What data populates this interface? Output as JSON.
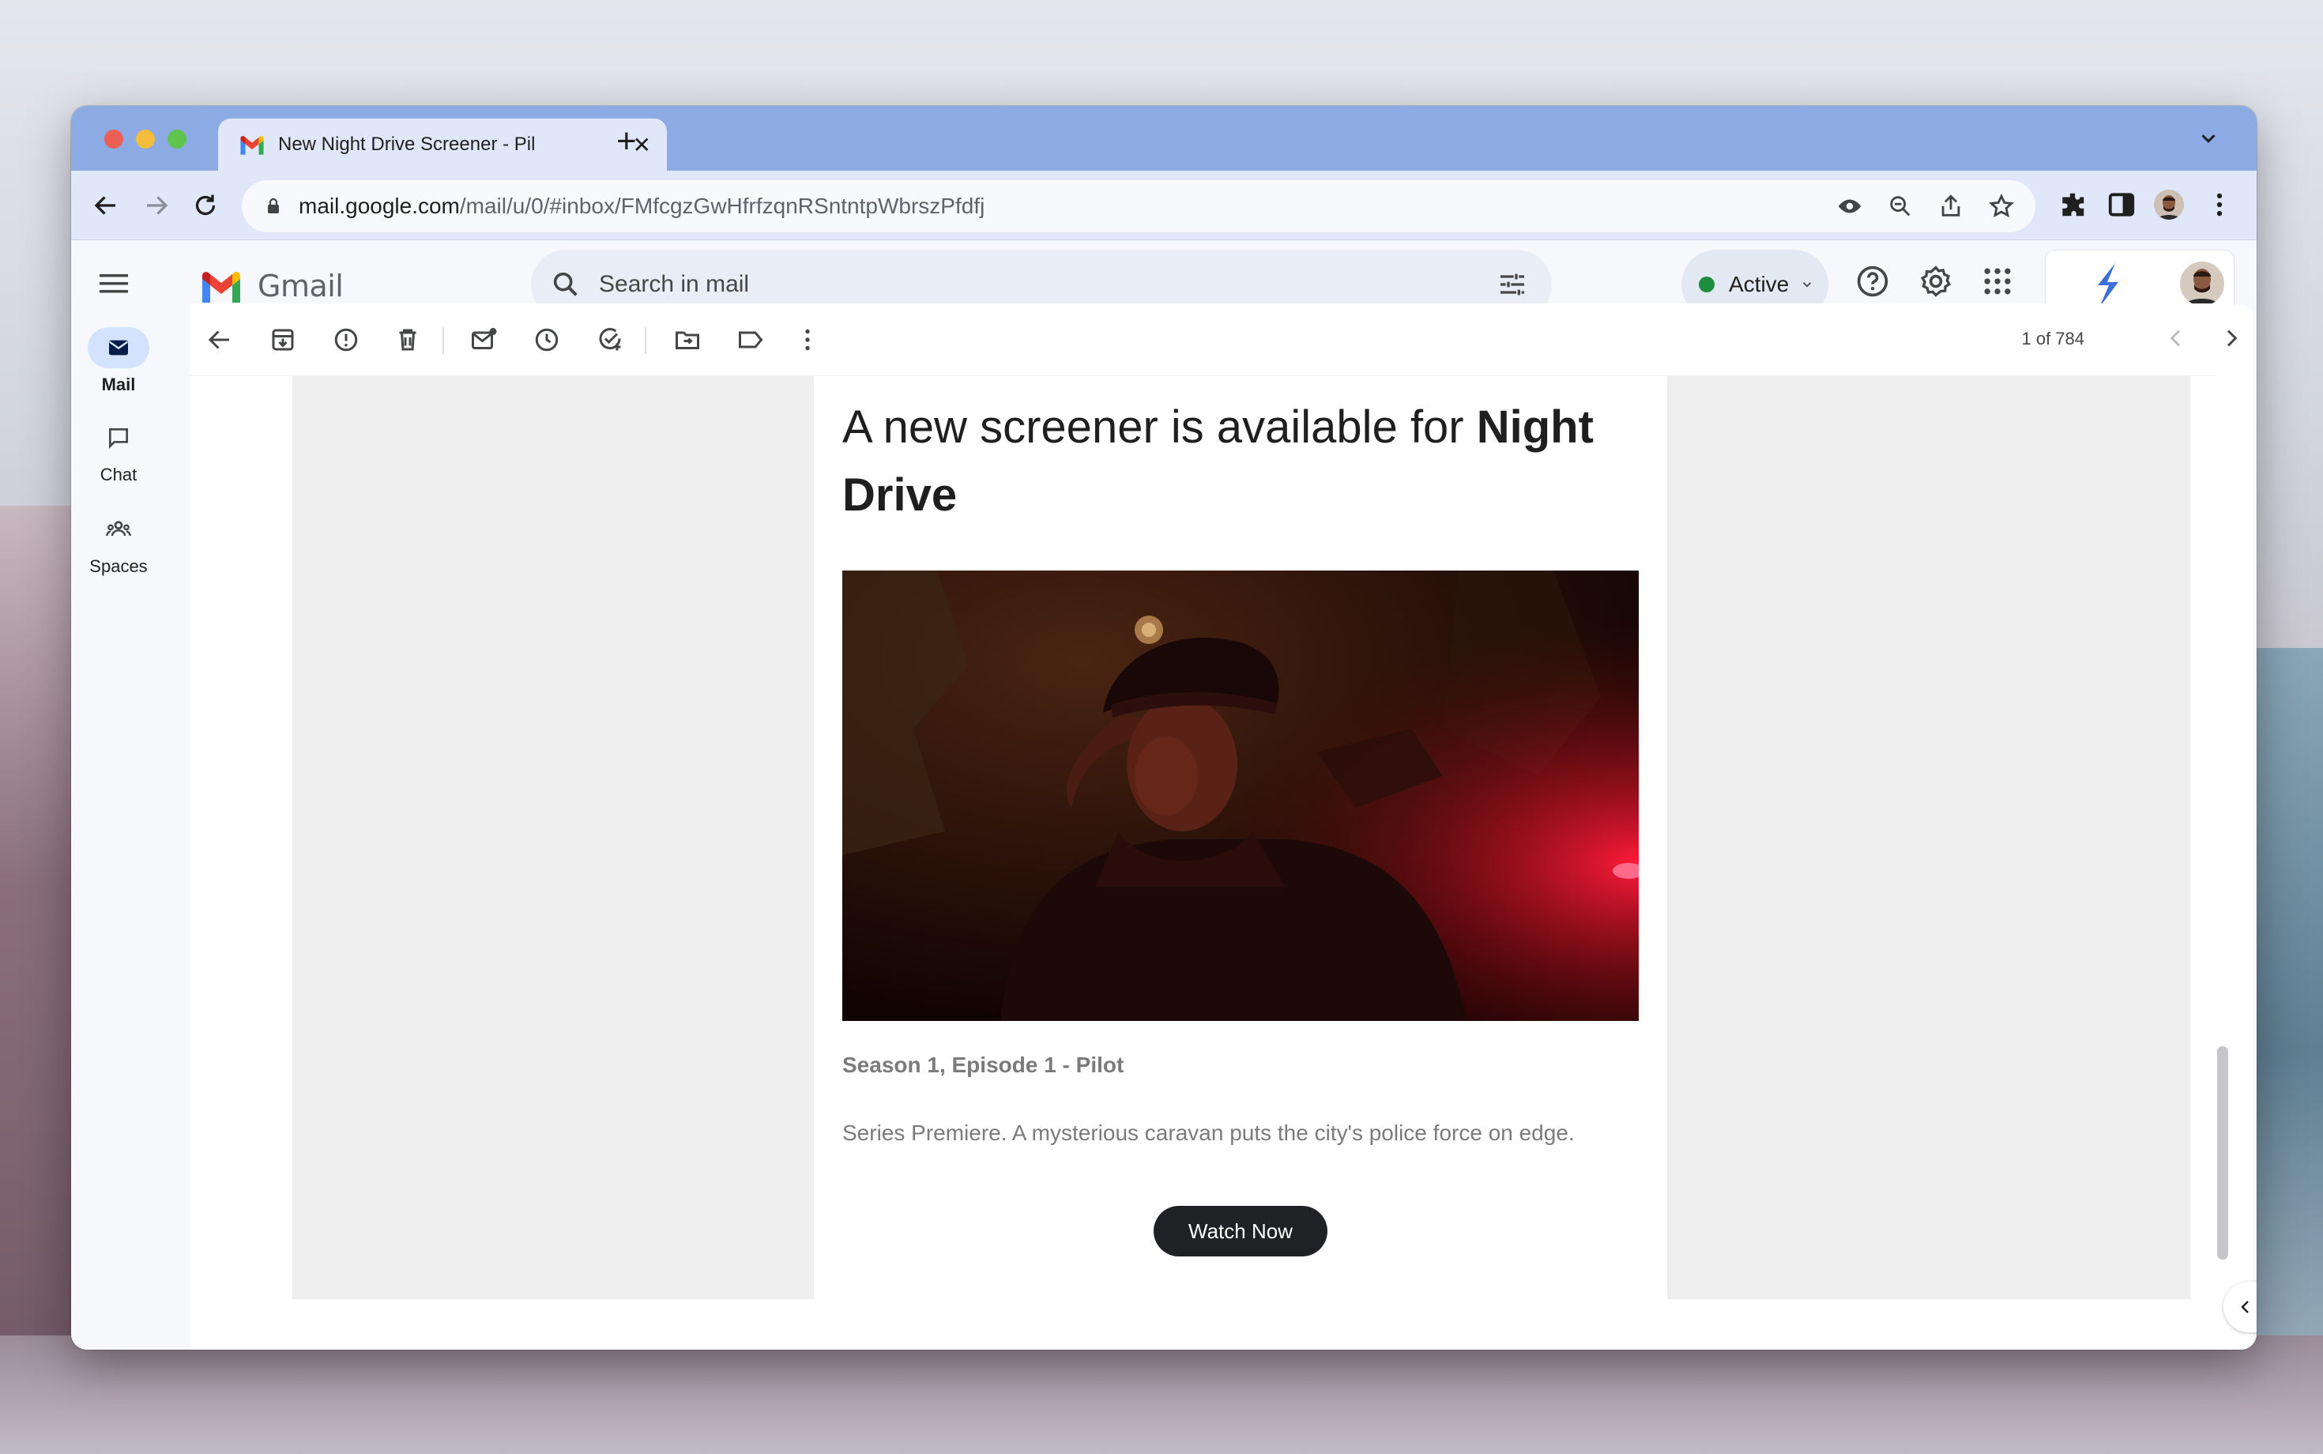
{
  "browser": {
    "tab_title": "New Night Drive Screener - Pil",
    "url_host": "mail.google.com",
    "url_path": "/mail/u/0/#inbox/FMfcgzGwHfrfzqnRSntntpWbrszPfdfj"
  },
  "gmail": {
    "app_name": "Gmail",
    "search_placeholder": "Search in mail",
    "status_label": "Active",
    "status_color": "#1e8e3e",
    "accent_color": "#d3e3fd"
  },
  "rail": [
    {
      "label": "Mail",
      "icon": "mail-icon",
      "active": true
    },
    {
      "label": "Chat",
      "icon": "chat-icon",
      "active": false
    },
    {
      "label": "Spaces",
      "icon": "spaces-icon",
      "active": false
    }
  ],
  "mail_toolbar": {
    "pager_text": "1 of 784"
  },
  "email": {
    "headline_prefix": "A new screener is available for ",
    "headline_bold": "Night Drive",
    "episode_title": "Season 1, Episode 1 - Pilot",
    "episode_desc": "Series Premiere. A mysterious caravan puts the city's police force on edge.",
    "cta_label": "Watch Now"
  }
}
